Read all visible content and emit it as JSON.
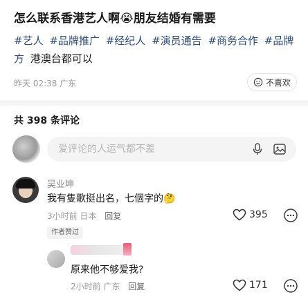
{
  "post": {
    "title": "怎么联系香港艺人啊😭朋友结婚有需要",
    "tags": [
      "#艺人",
      "#品牌推广",
      "#经纪人",
      "#演员通告",
      "#商务合作",
      "#品牌方"
    ],
    "tags_tail": "港澳台都可以",
    "meta": "昨天 02:38 广东",
    "dislike_label": "不喜欢"
  },
  "comments_header": {
    "count_label": "共 398 条评论"
  },
  "comment_input": {
    "placeholder": "爱评论的人运气都不差"
  },
  "comment": {
    "author": "吴业坤",
    "text": "我有隻歌挺出名，七個字的🤔",
    "meta": "3小时前 日本",
    "reply_label": "回复",
    "likes": "395",
    "badge": "作者赞过"
  },
  "reply": {
    "text": "原来他不够爱我?",
    "meta": "2小时前 广东",
    "reply_label": "回复",
    "likes": "171"
  },
  "colors": {
    "tag": "#2b4b7e",
    "muted": "#999999",
    "text": "#1a1a1a"
  },
  "icons": [
    "dislike-icon",
    "mic-icon",
    "image-icon",
    "heart-icon",
    "more-icon"
  ]
}
